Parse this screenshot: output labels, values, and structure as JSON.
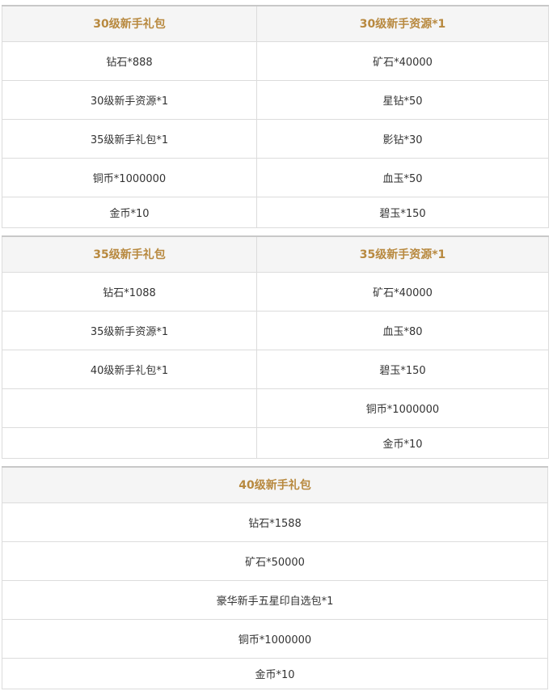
{
  "tables": [
    {
      "headers": [
        "30级新手礼包",
        "30级新手资源*1"
      ],
      "rows": [
        [
          "钻石*888",
          "矿石*40000"
        ],
        [
          "30级新手资源*1",
          "星钻*50"
        ],
        [
          "35级新手礼包*1",
          "影钻*30"
        ],
        [
          "铜币*1000000",
          "血玉*50"
        ],
        [
          "金币*10",
          "碧玉*150"
        ]
      ]
    },
    {
      "headers": [
        "35级新手礼包",
        "35级新手资源*1"
      ],
      "rows": [
        [
          "钻石*1088",
          "矿石*40000"
        ],
        [
          "35级新手资源*1",
          "血玉*80"
        ],
        [
          "40级新手礼包*1",
          "碧玉*150"
        ],
        [
          "",
          "铜币*1000000"
        ],
        [
          "",
          "金币*10"
        ]
      ]
    },
    {
      "headers": [
        "40级新手礼包"
      ],
      "rows": [
        [
          "钻石*1588"
        ],
        [
          "矿石*50000"
        ],
        [
          "豪华新手五星印自选包*1"
        ],
        [
          "铜币*1000000"
        ],
        [
          "金币*10"
        ]
      ]
    }
  ]
}
